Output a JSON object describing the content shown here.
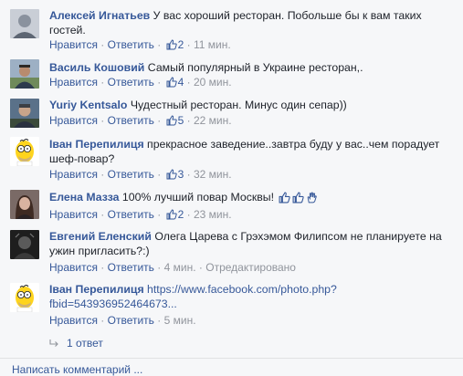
{
  "labels": {
    "like": "Нравится",
    "reply": "Ответить",
    "dot": "·"
  },
  "comments": [
    {
      "author": "Алексей Игнатьев",
      "text": "У вас хороший ресторан. Побольше бы к вам таких гостей.",
      "likes": "2",
      "time": "11 мин.",
      "avatar_icon": "user-photo-icon"
    },
    {
      "author": "Василь Кошовий",
      "text": "Самый популярный в Украине ресторан,.",
      "likes": "4",
      "time": "20 мин.",
      "avatar_icon": "user-photo-icon"
    },
    {
      "author": "Yuriy Kentsalo",
      "text": "Чудестный ресторан. Минус один сепар))",
      "likes": "5",
      "time": "22 мин.",
      "avatar_icon": "user-photo-icon"
    },
    {
      "author": "Іван Перепилиця",
      "text": "прекрасное заведение..завтра буду у вас..чем порадует шеф-повар?",
      "likes": "3",
      "time": "32 мин.",
      "avatar_icon": "homer-simpson-avatar-icon"
    },
    {
      "author": "Елена Мазза",
      "text": "100% лучший повар Москвы!",
      "likes": "2",
      "time": "23 мин.",
      "avatar_icon": "user-photo-icon",
      "emoji_icons": [
        "thumbs-up-icon",
        "thumbs-up-icon",
        "hand-icon"
      ]
    },
    {
      "author": "Евгений Еленский",
      "text": "Олега Царева с Грэхэмом Филипсом не планируете на ужин пригласить?:)",
      "time": "4 мин.",
      "edited": "Отредактировано",
      "avatar_icon": "user-photo-icon"
    },
    {
      "author": "Іван Перепилиця",
      "link": "https://www.facebook.com/photo.php?fbid=543936952464673...",
      "time": "5 мин.",
      "avatar_icon": "homer-simpson-avatar-icon"
    }
  ],
  "replies": {
    "label": "1 ответ",
    "icon": "reply-arrow-icon"
  },
  "footer": {
    "write_comment": "Написать комментарий ..."
  },
  "colors": {
    "link": "#365899",
    "meta": "#90949c",
    "text": "#1d2129",
    "background": "#f6f7f9"
  }
}
